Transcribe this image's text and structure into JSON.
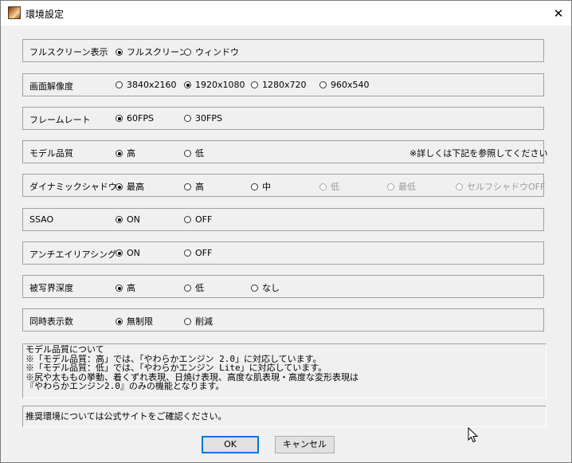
{
  "window": {
    "title": "環境設定",
    "close_glyph": "✕"
  },
  "settings": [
    {
      "label": "フルスクリーン表示",
      "options": [
        {
          "label": "フルスクリーン",
          "checked": true
        },
        {
          "label": "ウィンドウ",
          "checked": false
        }
      ]
    },
    {
      "label": "画面解像度",
      "options": [
        {
          "label": "3840x2160",
          "checked": false
        },
        {
          "label": "1920x1080",
          "checked": true
        },
        {
          "label": "1280x720",
          "checked": false
        },
        {
          "label": "960x540",
          "checked": false
        }
      ]
    },
    {
      "label": "フレームレート",
      "options": [
        {
          "label": "60FPS",
          "checked": true
        },
        {
          "label": "30FPS",
          "checked": false
        }
      ]
    },
    {
      "label": "モデル品質",
      "options": [
        {
          "label": "高",
          "checked": true
        },
        {
          "label": "低",
          "checked": false
        }
      ],
      "note": "※詳しくは下記を参照してください"
    },
    {
      "label": "ダイナミックシャドウ",
      "options": [
        {
          "label": "最高",
          "checked": true
        },
        {
          "label": "高",
          "checked": false
        },
        {
          "label": "中",
          "checked": false
        },
        {
          "label": "低",
          "checked": false,
          "disabled": true
        },
        {
          "label": "最低",
          "checked": false,
          "disabled": true
        },
        {
          "label": "セルフシャドウOFF",
          "checked": false,
          "disabled": true
        }
      ]
    },
    {
      "label": "SSAO",
      "options": [
        {
          "label": "ON",
          "checked": true
        },
        {
          "label": "OFF",
          "checked": false
        }
      ]
    },
    {
      "label": "アンチエイリアシング",
      "options": [
        {
          "label": "ON",
          "checked": true
        },
        {
          "label": "OFF",
          "checked": false
        }
      ]
    },
    {
      "label": "被写界深度",
      "options": [
        {
          "label": "高",
          "checked": true
        },
        {
          "label": "低",
          "checked": false
        },
        {
          "label": "なし",
          "checked": false
        }
      ]
    },
    {
      "label": "同時表示数",
      "options": [
        {
          "label": "無制限",
          "checked": true
        },
        {
          "label": "削減",
          "checked": false
        }
      ]
    }
  ],
  "notes": [
    "モデル品質について",
    "※「モデル品質：高」では、「やわらかエンジン 2.0」に対応しています。",
    "※「モデル品質：低」では、「やわらかエンジン Lite」に対応しています。",
    "※尻や太ももの挙動、着くずれ表現、日焼け表現、高度な肌表現・高度な変形表現は",
    "『やわらかエンジン2.0』のみの機能となります。"
  ],
  "recommendation": "推奨環境については公式サイトをご確認ください。",
  "buttons": {
    "ok": "OK",
    "cancel": "キャンセル"
  }
}
